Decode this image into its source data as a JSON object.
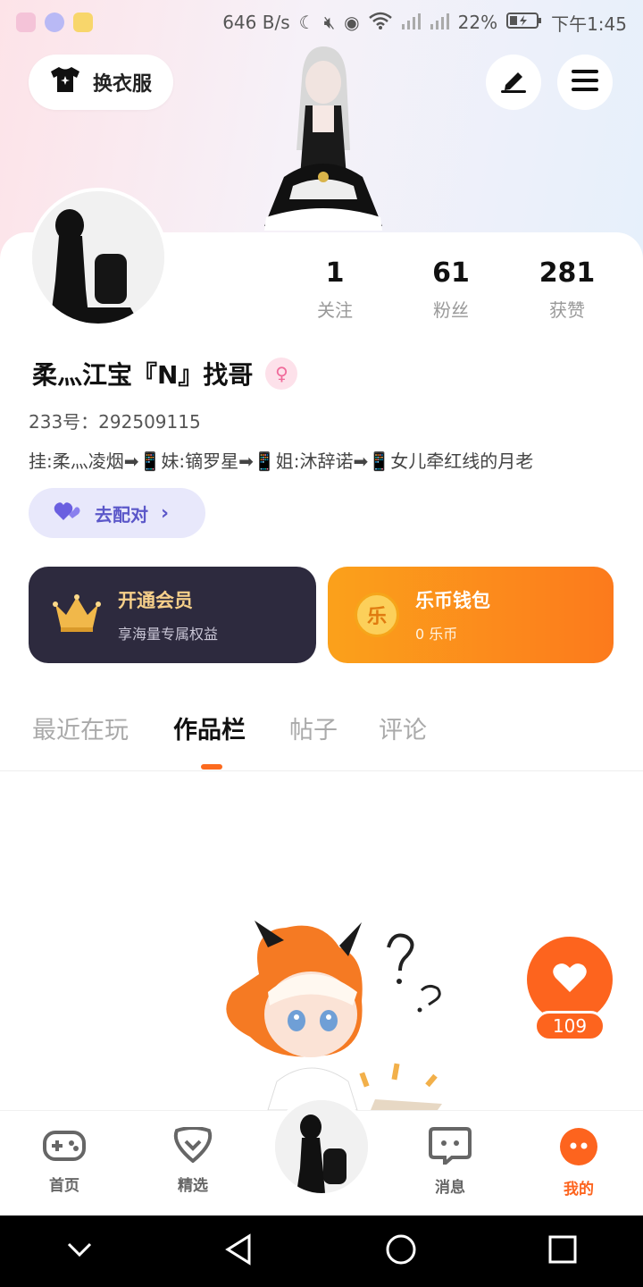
{
  "status_bar": {
    "speed": "646 B/s",
    "battery": "22%",
    "time": "下午1:45"
  },
  "top": {
    "outfit_label": "换衣服",
    "edit_icon": "pen-icon",
    "menu_icon": "hamburger-menu-icon"
  },
  "stats": [
    {
      "value": "1",
      "label": "关注"
    },
    {
      "value": "61",
      "label": "粉丝"
    },
    {
      "value": "281",
      "label": "获赞"
    }
  ],
  "profile": {
    "nickname": "柔灬江宝『N』找哥",
    "gender_icon": "female-symbol-icon",
    "uid": "233号：292509115",
    "bio": "挂:柔灬凌烟➡📱妹:镝罗星➡📱姐:沐辞诺➡📱女儿牵红线的月老"
  },
  "match": {
    "label": "去配对"
  },
  "cards": {
    "vip": {
      "title": "开通会员",
      "subtitle": "享海量专属权益"
    },
    "wallet": {
      "title": "乐币钱包",
      "subtitle": "0 乐币",
      "coin_char": "乐"
    }
  },
  "tabs": [
    {
      "label": "最近在玩",
      "active": false
    },
    {
      "label": "作品栏",
      "active": true
    },
    {
      "label": "帖子",
      "active": false
    },
    {
      "label": "评论",
      "active": false
    }
  ],
  "like": {
    "count": "109"
  },
  "bottom_nav": [
    {
      "label": "首页",
      "icon": "gamepad-icon",
      "active": false
    },
    {
      "label": "精选",
      "icon": "heart-chat-icon",
      "active": false
    },
    {
      "label": "消息",
      "icon": "message-icon",
      "active": false
    },
    {
      "label": "我的",
      "icon": "profile-dots-icon",
      "active": true
    }
  ],
  "colors": {
    "accent": "#fd641e",
    "vip_bg": "#2d2a3e",
    "match_bg": "#e8e8fb",
    "match_text": "#5b57c9"
  }
}
